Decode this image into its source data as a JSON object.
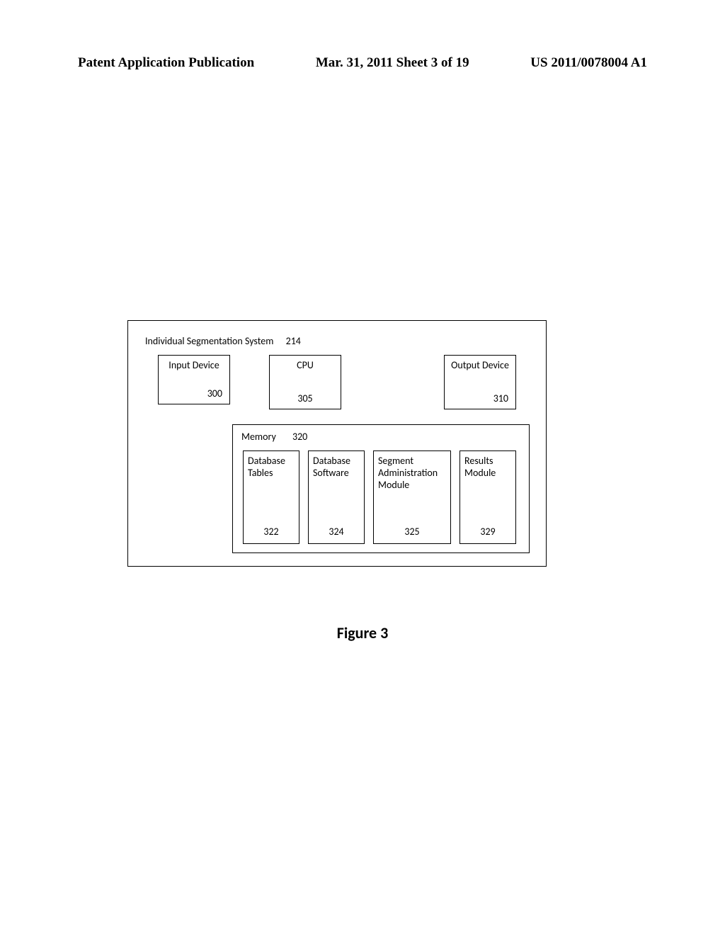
{
  "header": {
    "left": "Patent Application Publication",
    "mid": "Mar. 31, 2011  Sheet 3 of 19",
    "right": "US 2011/0078004 A1"
  },
  "system": {
    "title": "Individual Segmentation System",
    "title_num": "214",
    "input": {
      "label": "Input Device",
      "num": "300"
    },
    "cpu": {
      "label": "CPU",
      "num": "305"
    },
    "output": {
      "label": "Output Device",
      "num": "310"
    },
    "memory": {
      "title": "Memory",
      "title_num": "320",
      "modules": [
        {
          "label": "Database Tables",
          "num": "322"
        },
        {
          "label": "Database Software",
          "num": "324"
        },
        {
          "label": "Segment Administration Module",
          "num": "325"
        },
        {
          "label": "Results Module",
          "num": "329"
        }
      ]
    }
  },
  "caption": "Figure 3"
}
